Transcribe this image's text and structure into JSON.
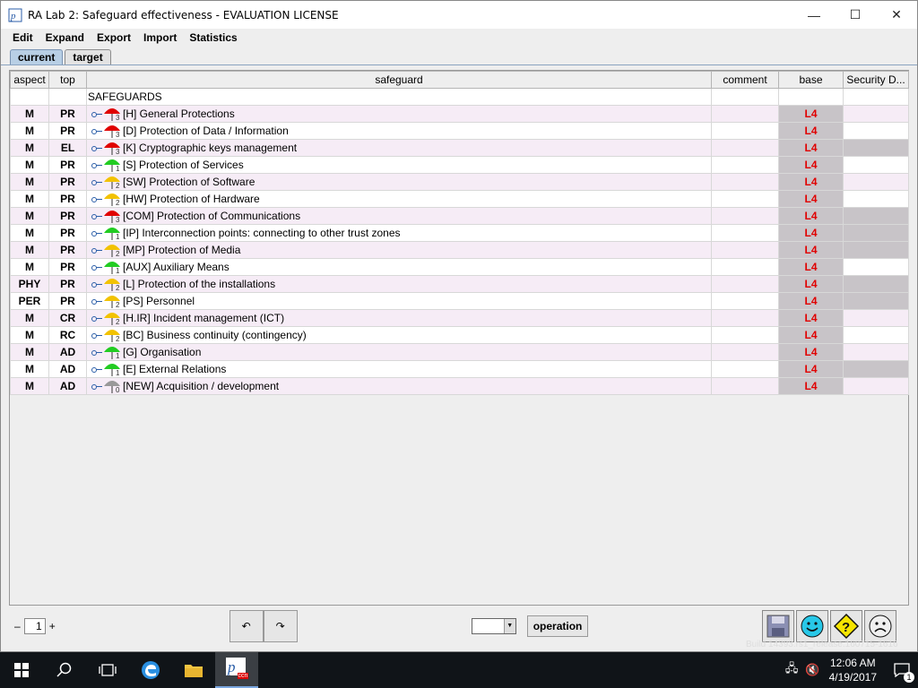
{
  "window": {
    "title": "RA Lab 2: Safeguard effectiveness - EVALUATION LICENSE"
  },
  "menu": [
    "Edit",
    "Expand",
    "Export",
    "Import",
    "Statistics"
  ],
  "tabs": [
    {
      "label": "current",
      "active": true
    },
    {
      "label": "target",
      "active": false
    }
  ],
  "columns": [
    "aspect",
    "top",
    "safeguard",
    "comment",
    "base",
    "Security D..."
  ],
  "root_label": "SAFEGUARDS",
  "rows": [
    {
      "aspect": "M",
      "top": "PR",
      "safeguard": "[H] General Protections",
      "color": "#e00000",
      "level": "3",
      "base": "L4",
      "sec_grey": false
    },
    {
      "aspect": "M",
      "top": "PR",
      "safeguard": "[D] Protection of Data / Information",
      "color": "#e00000",
      "level": "3",
      "base": "L4",
      "sec_grey": false
    },
    {
      "aspect": "M",
      "top": "EL",
      "safeguard": "[K] Cryptographic keys management",
      "color": "#e00000",
      "level": "3",
      "base": "L4",
      "sec_grey": true
    },
    {
      "aspect": "M",
      "top": "PR",
      "safeguard": "[S] Protection of Services",
      "color": "#22cc22",
      "level": "1",
      "base": "L4",
      "sec_grey": false
    },
    {
      "aspect": "M",
      "top": "PR",
      "safeguard": "[SW] Protection of Software",
      "color": "#f2c200",
      "level": "2",
      "base": "L4",
      "sec_grey": false
    },
    {
      "aspect": "M",
      "top": "PR",
      "safeguard": "[HW] Protection of Hardware",
      "color": "#f2c200",
      "level": "2",
      "base": "L4",
      "sec_grey": false
    },
    {
      "aspect": "M",
      "top": "PR",
      "safeguard": "[COM] Protection of Communications",
      "color": "#e00000",
      "level": "3",
      "base": "L4",
      "sec_grey": true
    },
    {
      "aspect": "M",
      "top": "PR",
      "safeguard": "[IP] Interconnection points: connecting to other trust zones",
      "color": "#22cc22",
      "level": "1",
      "base": "L4",
      "sec_grey": true
    },
    {
      "aspect": "M",
      "top": "PR",
      "safeguard": "[MP] Protection of Media",
      "color": "#f2c200",
      "level": "2",
      "base": "L4",
      "sec_grey": true
    },
    {
      "aspect": "M",
      "top": "PR",
      "safeguard": "[AUX] Auxiliary Means",
      "color": "#22cc22",
      "level": "1",
      "base": "L4",
      "sec_grey": false
    },
    {
      "aspect": "PHY",
      "top": "PR",
      "safeguard": "[L] Protection of the installations",
      "color": "#f2c200",
      "level": "2",
      "base": "L4",
      "sec_grey": true
    },
    {
      "aspect": "PER",
      "top": "PR",
      "safeguard": "[PS] Personnel",
      "color": "#f2c200",
      "level": "2",
      "base": "L4",
      "sec_grey": true
    },
    {
      "aspect": "M",
      "top": "CR",
      "safeguard": "[H.IR] Incident management (ICT)",
      "color": "#f2c200",
      "level": "2",
      "base": "L4",
      "sec_grey": false
    },
    {
      "aspect": "M",
      "top": "RC",
      "safeguard": "[BC] Business continuity (contingency)",
      "color": "#f2c200",
      "level": "2",
      "base": "L4",
      "sec_grey": false
    },
    {
      "aspect": "M",
      "top": "AD",
      "safeguard": "[G] Organisation",
      "color": "#22cc22",
      "level": "1",
      "base": "L4",
      "sec_grey": false
    },
    {
      "aspect": "M",
      "top": "AD",
      "safeguard": "[E] External Relations",
      "color": "#22cc22",
      "level": "1",
      "base": "L4",
      "sec_grey": true
    },
    {
      "aspect": "M",
      "top": "AD",
      "safeguard": "[NEW] Acquisition / development",
      "color": "#999999",
      "level": "0",
      "base": "L4",
      "sec_grey": false
    }
  ],
  "bottom": {
    "page_minus": "–",
    "page_value": "1",
    "page_plus": "+",
    "operation_label": "operation"
  },
  "build_text": "Build 14393.rs1_release.160715-1616",
  "taskbar": {
    "time": "12:06 AM",
    "date": "4/19/2017",
    "notif_count": "1",
    "app_badge": "ccn"
  }
}
